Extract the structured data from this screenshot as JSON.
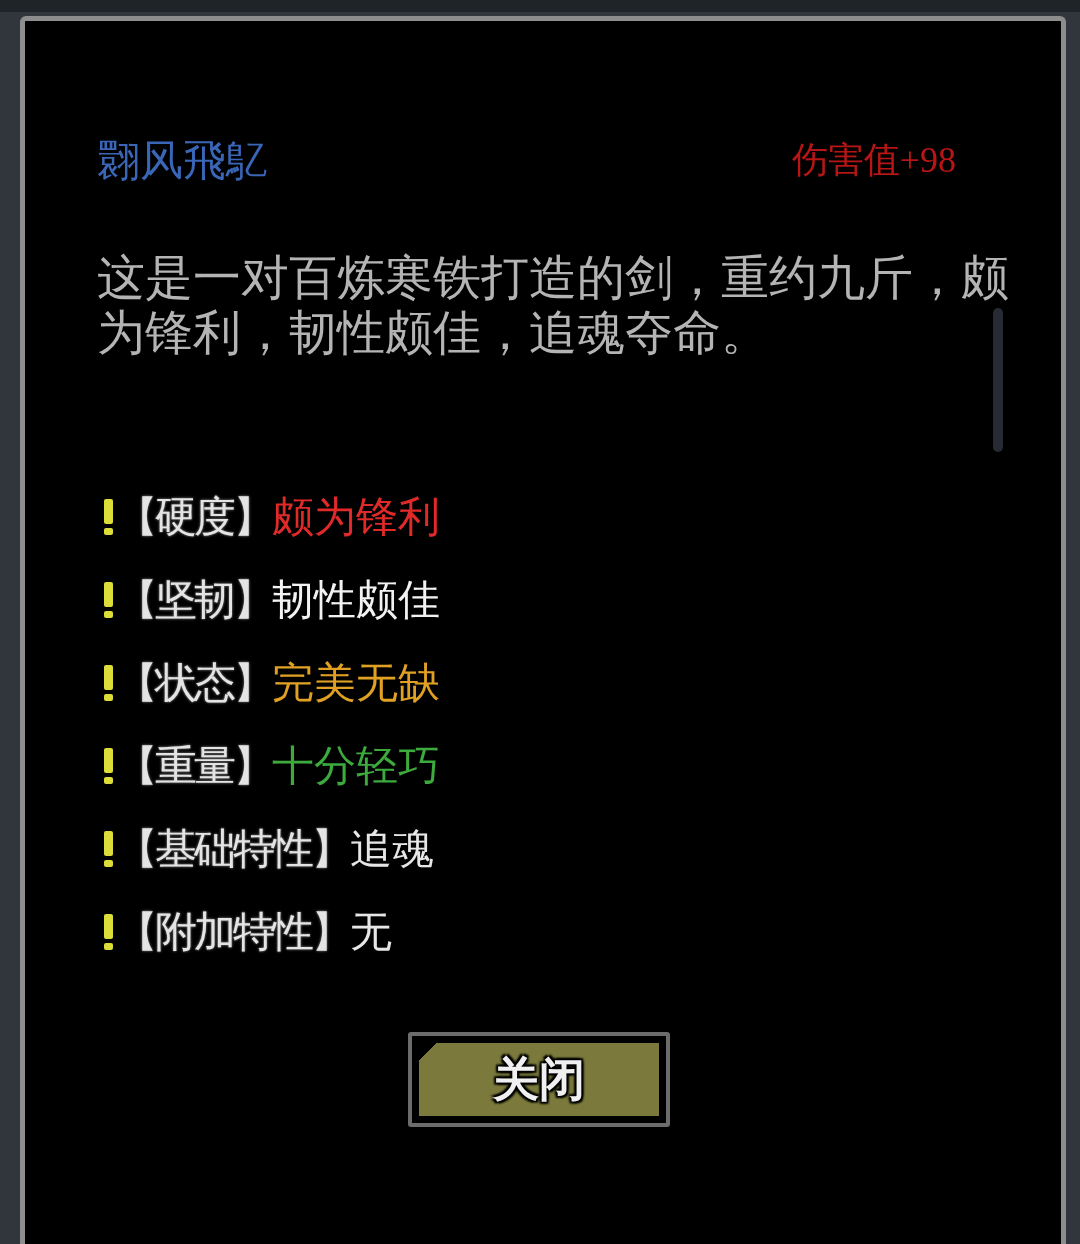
{
  "item": {
    "name": "翾风飛鳦",
    "damage": "伤害值+98",
    "description": "这是一对百炼寒铁打造的剑，重约九斤，颇为锋利，韧性颇佳，追魂夺命。"
  },
  "attributes": [
    {
      "label": "【硬度】",
      "value": "颇为锋利",
      "color": "#e02a2a"
    },
    {
      "label": "【坚韧】",
      "value": "韧性颇佳",
      "color": "#f2f2f2"
    },
    {
      "label": "【状态】",
      "value": "完美无缺",
      "color": "#e0a024"
    },
    {
      "label": "【重量】",
      "value": "十分轻巧",
      "color": "#3caa3c"
    },
    {
      "label": "【基础特性】",
      "value": "追魂",
      "color": "#e6e6e6"
    },
    {
      "label": "【附加特性】",
      "value": "无",
      "color": "#e6e6e6"
    }
  ],
  "buttons": [
    {
      "label": "关闭"
    }
  ]
}
